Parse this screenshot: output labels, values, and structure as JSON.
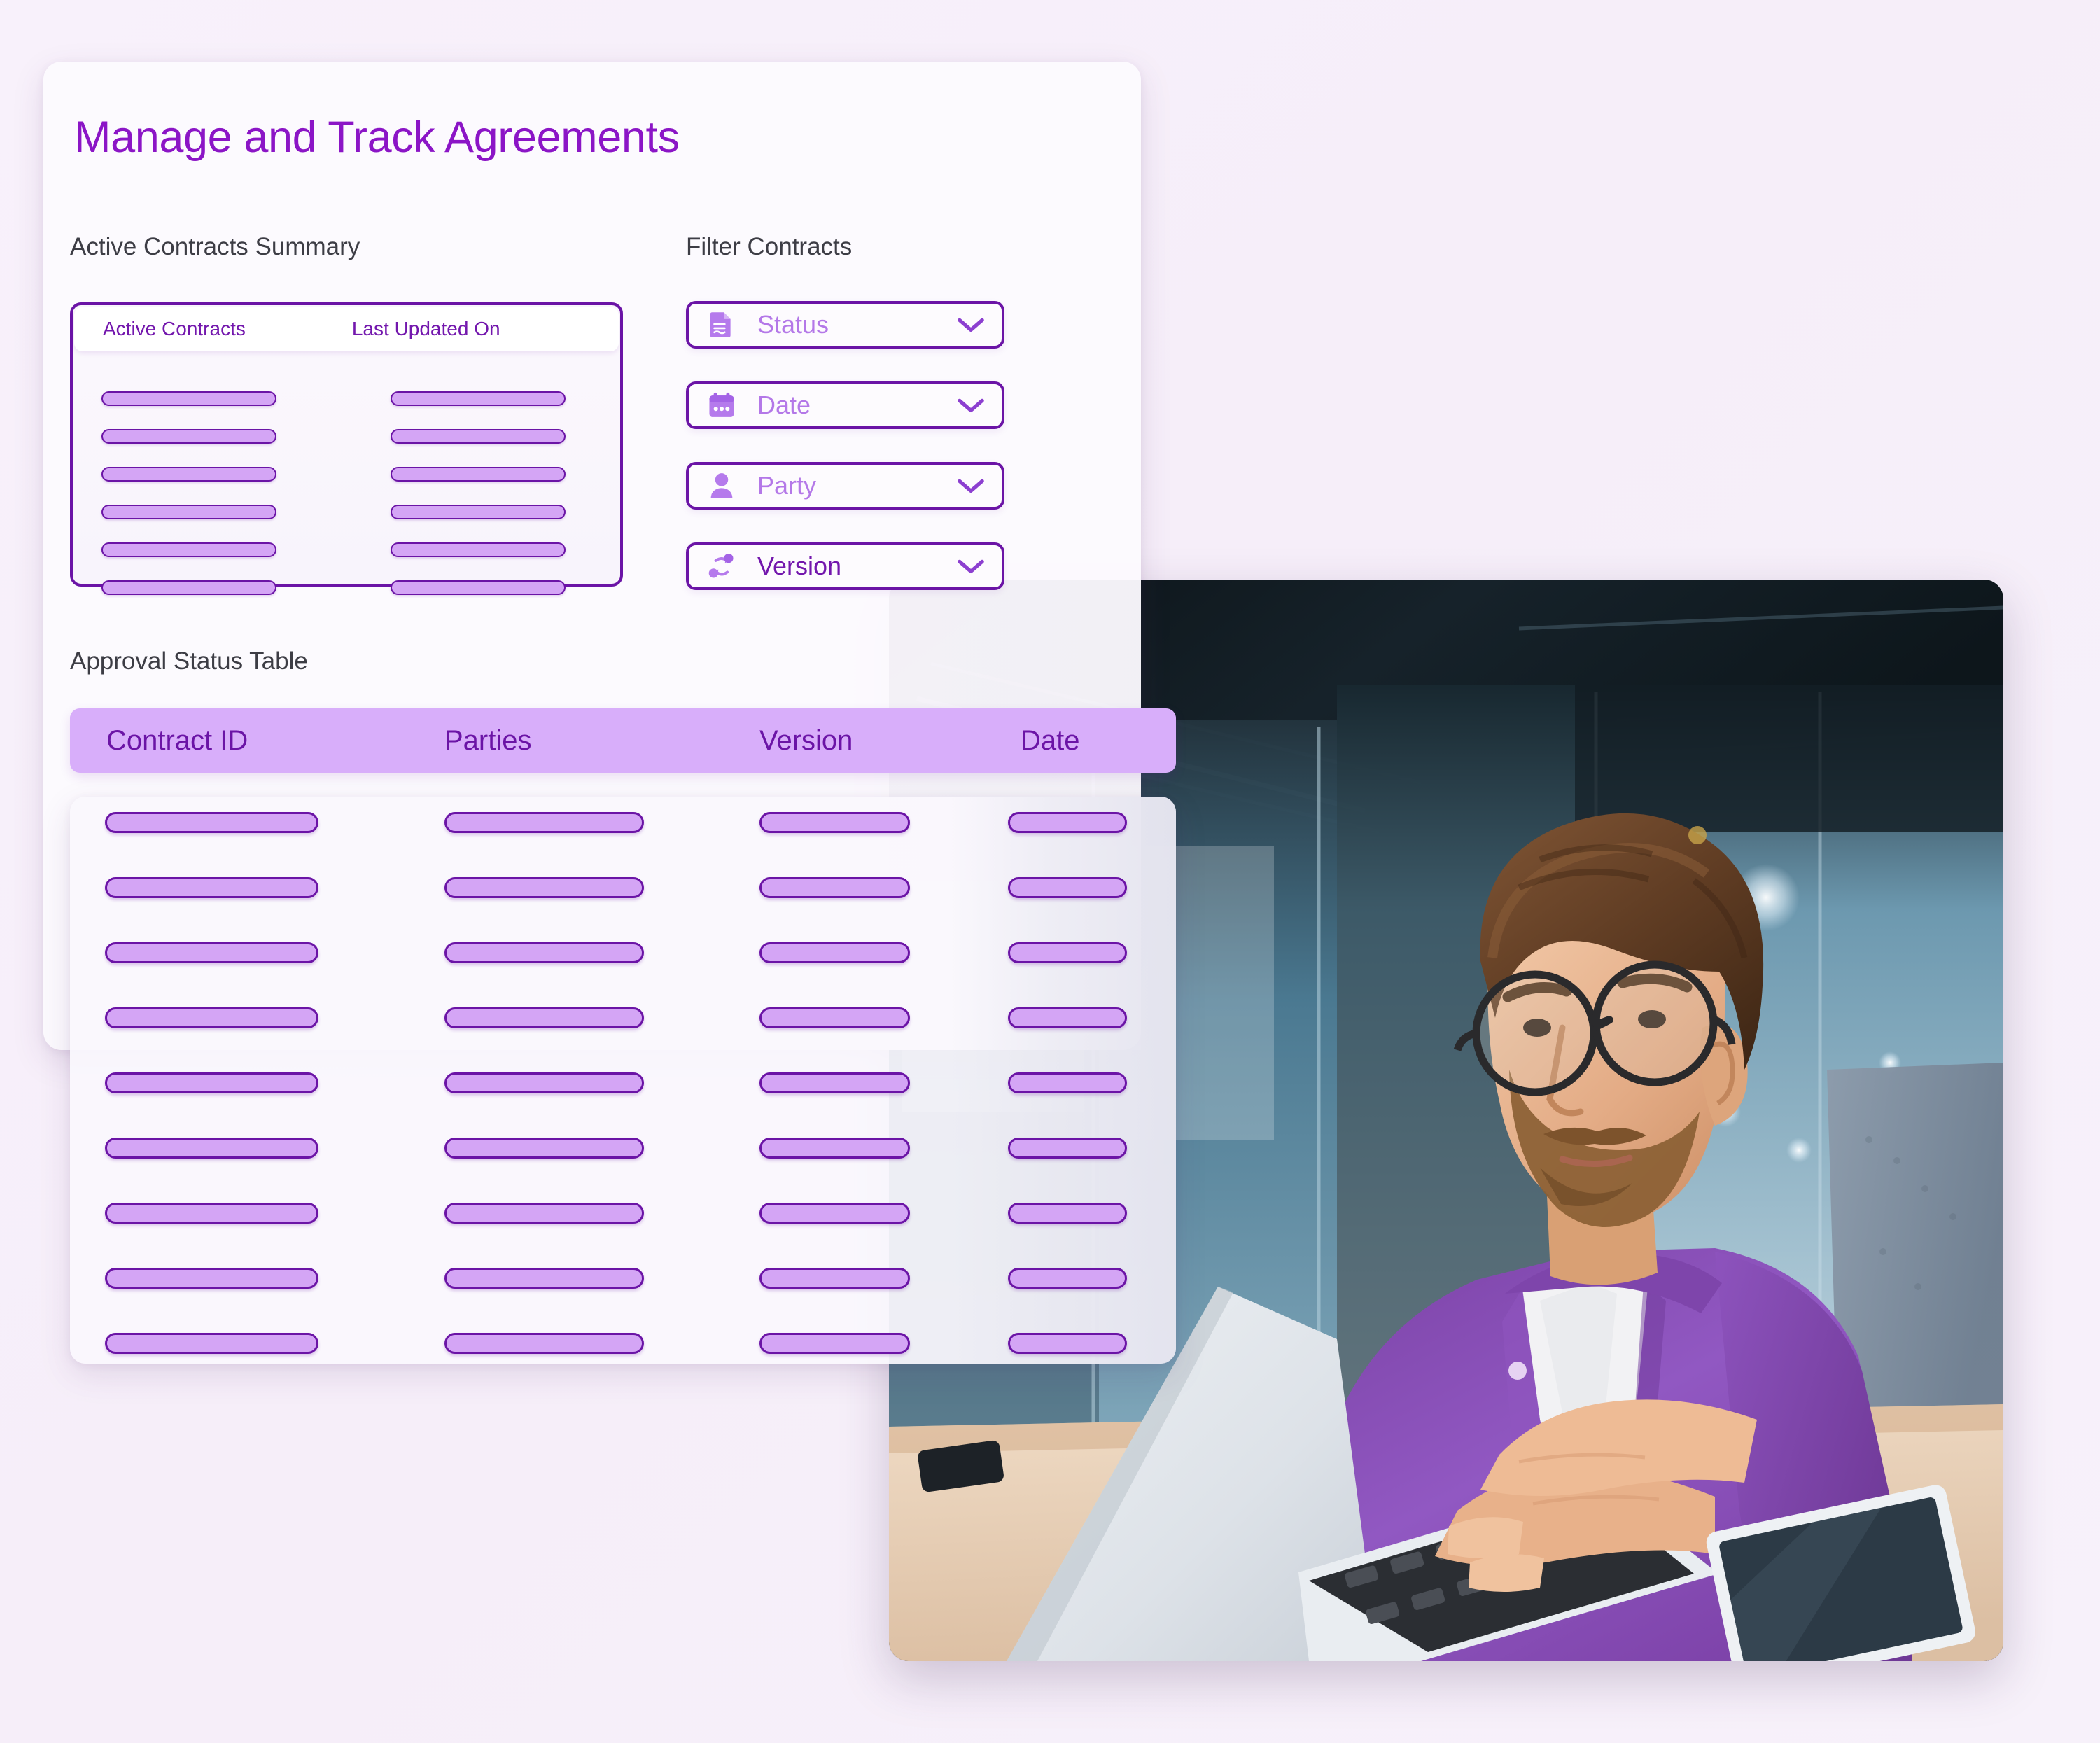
{
  "page": {
    "title": "Manage and Track Agreements",
    "background_color": "#f7f0fa",
    "accent_color": "#8b15c6",
    "pill_fill_color": "#d4a5f5",
    "pill_border_color": "#6b14a6"
  },
  "summary_section": {
    "label": "Active Contracts Summary",
    "columns": [
      "Active Contracts",
      "Last Updated On"
    ],
    "placeholder_row_count": 6
  },
  "filter_section": {
    "label": "Filter Contracts",
    "filters": [
      {
        "label": "Status",
        "icon": "document-icon",
        "chevron": "chevron-down-icon",
        "emphasis": false
      },
      {
        "label": "Date",
        "icon": "calendar-icon",
        "chevron": "chevron-down-icon",
        "emphasis": false
      },
      {
        "label": "Party",
        "icon": "person-icon",
        "chevron": "chevron-down-icon",
        "emphasis": false
      },
      {
        "label": "Version",
        "icon": "branch-icon",
        "chevron": "chevron-down-icon",
        "emphasis": true
      }
    ]
  },
  "approval_table": {
    "label": "Approval Status Table",
    "columns": [
      "Contract ID",
      "Parties",
      "Version",
      "Date"
    ],
    "placeholder_row_count": 9,
    "header_background": "#d8aefa"
  },
  "photo": {
    "alt": "Man with beard and round glasses in purple shirt typing on a laptop in a modern glass-walled office",
    "shirt_color": "#8a4fb5",
    "tshirt_color": "#f0f0f2",
    "hair_color": "#6b4328",
    "skin_color": "#e8b593",
    "desk_color": "#e7cfb6",
    "wall_color": "#7fa8bd",
    "dark_ceiling_color": "#121a1e",
    "laptop_color": "#dfe3e8",
    "tablet_color": "#2a3440"
  }
}
